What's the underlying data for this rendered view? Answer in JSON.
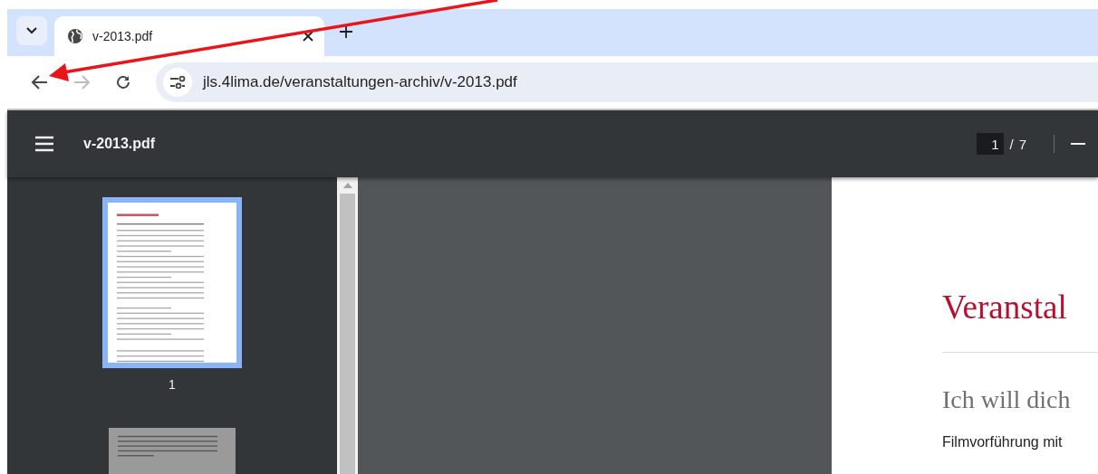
{
  "tab_strip": {
    "tabs": [
      {
        "title": "v-2013.pdf",
        "selected": true
      }
    ]
  },
  "toolbar": {
    "url": "jls.4lima.de/veranstaltungen-archiv/v-2013.pdf",
    "forward_disabled": true
  },
  "pdf_toolbar": {
    "title": "v-2013.pdf",
    "page": "1",
    "separator": "/",
    "page_count": "7"
  },
  "thumbnails": [
    {
      "label": "1",
      "selected": true
    },
    {
      "selected": false
    }
  ],
  "page": {
    "heading": "Veranstal",
    "subheading": "Ich will dich",
    "text": "Filmvorführung mit"
  }
}
